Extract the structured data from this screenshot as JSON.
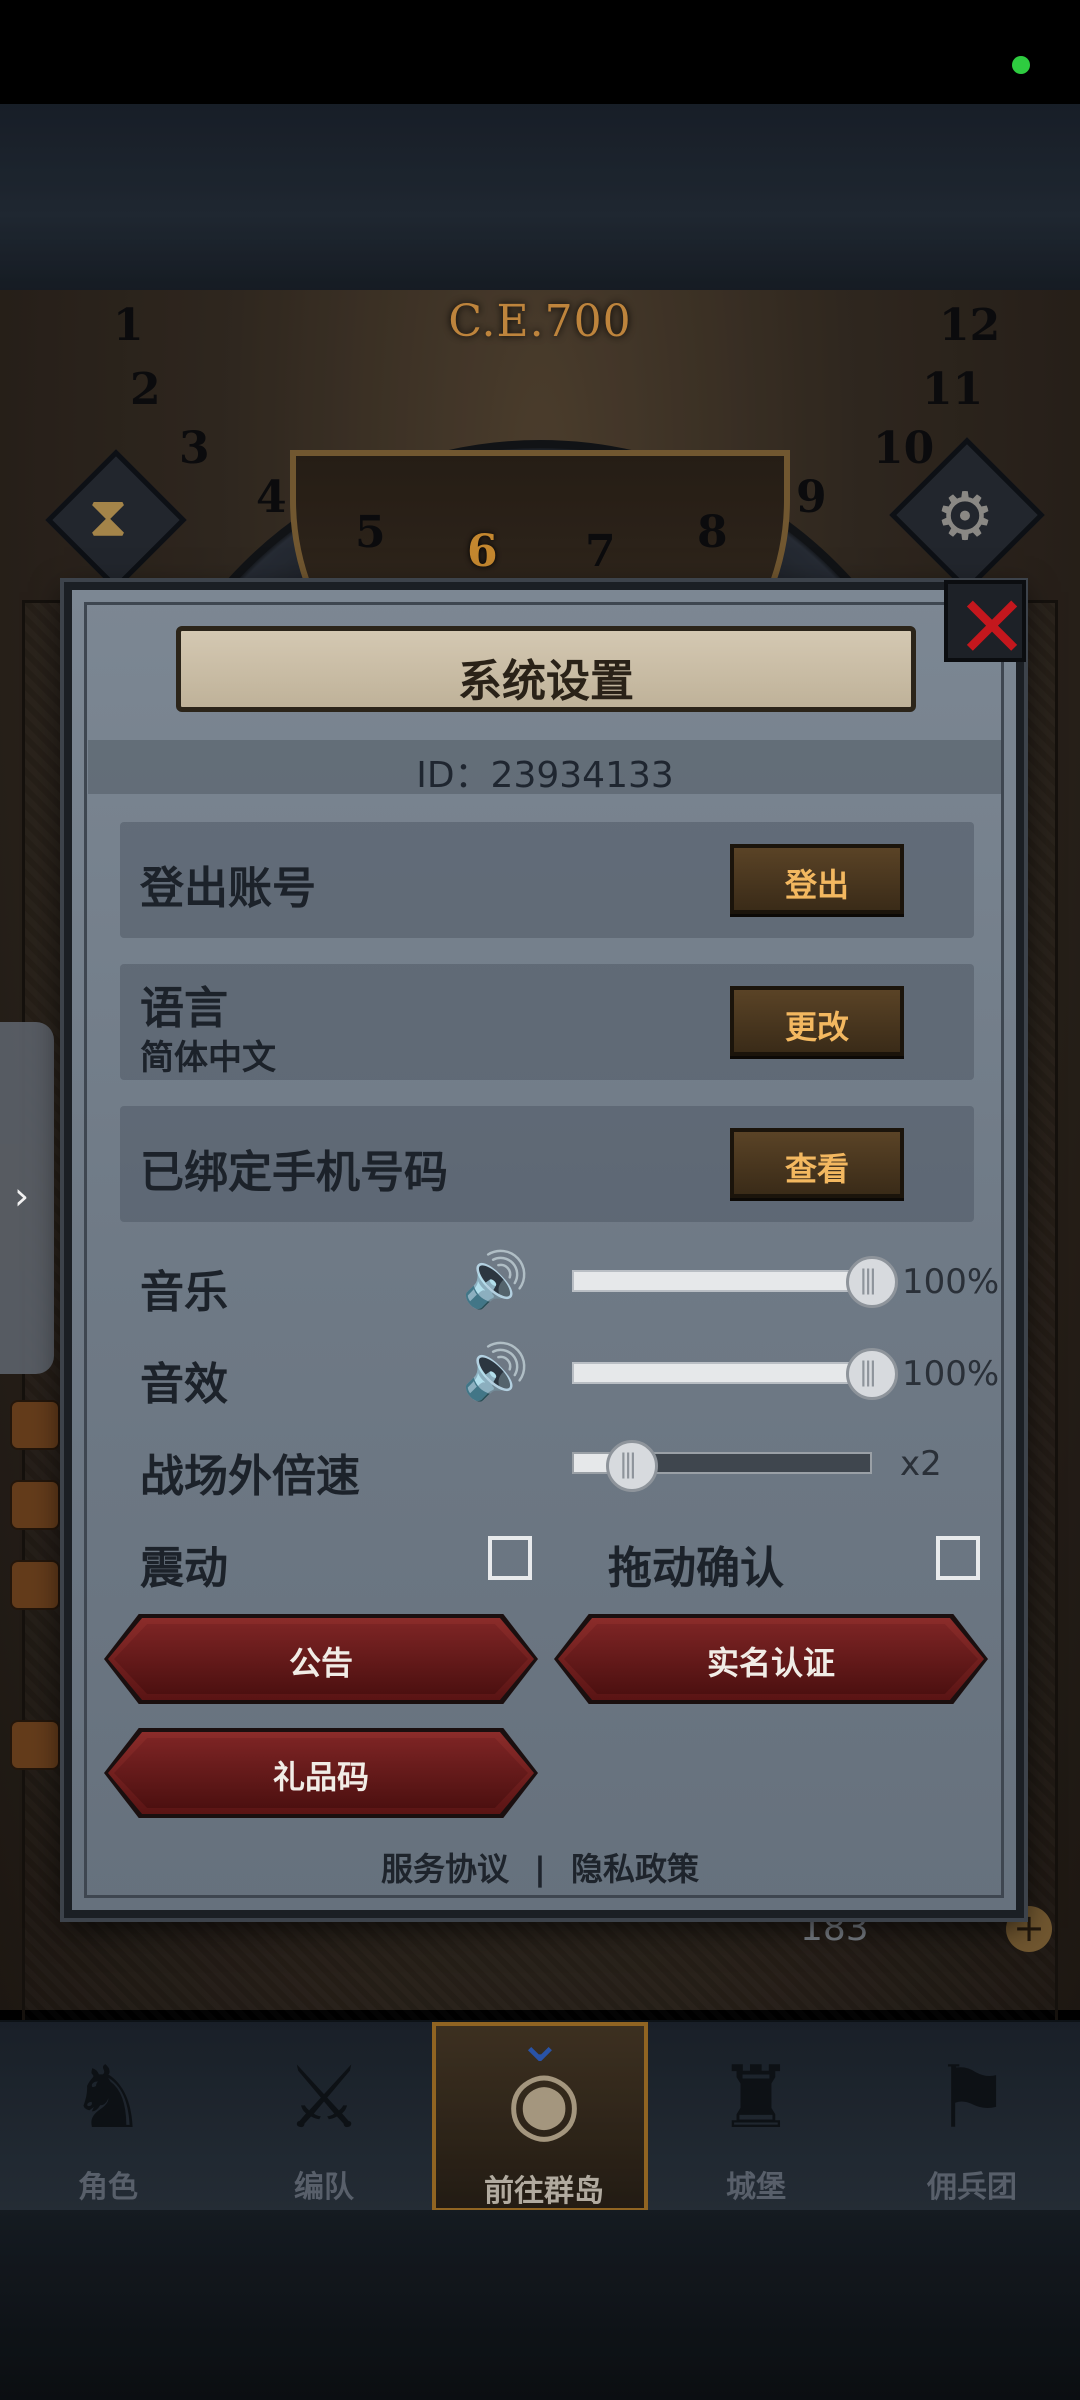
{
  "game": {
    "era_label": "C.E.700",
    "wheel_numbers": [
      "1",
      "2",
      "3",
      "4",
      "5",
      "6",
      "7",
      "8",
      "9",
      "10",
      "11",
      "12"
    ],
    "active_number": "6",
    "resource_count": "183"
  },
  "dialog": {
    "title": "系统设置",
    "id_text": "ID：23934133",
    "rows": {
      "logout": {
        "label": "登出账号",
        "button": "登出"
      },
      "language": {
        "label": "语言",
        "value": "简体中文",
        "button": "更改"
      },
      "phone": {
        "label": "已绑定手机号码",
        "button": "查看"
      }
    },
    "audio": {
      "music": {
        "label": "音乐",
        "value_text": "100%",
        "level": 1.0
      },
      "sfx": {
        "label": "音效",
        "value_text": "100%",
        "level": 1.0
      },
      "speed": {
        "label": "战场外倍速",
        "value_text": "x2",
        "level": 0.2
      }
    },
    "toggles": {
      "vibration": {
        "label": "震动",
        "checked": false
      },
      "drag_confirm": {
        "label": "拖动确认",
        "checked": false
      }
    },
    "buttons": {
      "notice": "公告",
      "real_name": "实名认证",
      "gift_code": "礼品码"
    },
    "footer": {
      "terms": "服务协议",
      "separator": "|",
      "privacy": "隐私政策"
    }
  },
  "nav": {
    "items": [
      {
        "label": "角色",
        "icon": "knight-icon"
      },
      {
        "label": "编队",
        "icon": "team-icon"
      },
      {
        "label": "前往群岛",
        "icon": "island-map-icon"
      },
      {
        "label": "城堡",
        "icon": "castle-icon"
      },
      {
        "label": "佣兵团",
        "icon": "mercenary-icon"
      }
    ],
    "active_index": 2
  },
  "colors": {
    "accent_gold": "#f3b860",
    "close_red": "#c4171d",
    "nav_active_border": "#b07a2a"
  }
}
